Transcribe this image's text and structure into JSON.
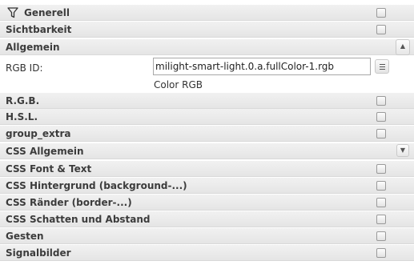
{
  "groups_top": [
    {
      "label": "Generell",
      "icon": "filter-icon"
    },
    {
      "label": "Sichtbarkeit"
    },
    {
      "label": "Allgemein"
    }
  ],
  "rgb": {
    "label": "RGB ID:",
    "value": "milight-smart-light.0.a.fullColor-1.rgb",
    "hint": "Color RGB",
    "select_icon": "list-icon"
  },
  "groups_bottom": [
    {
      "label": "R.G.B."
    },
    {
      "label": "H.S.L."
    },
    {
      "label": "group_extra"
    },
    {
      "label": "CSS Allgemein"
    },
    {
      "label": "CSS Font & Text"
    },
    {
      "label": "CSS Hintergrund (background-...)"
    },
    {
      "label": "CSS Ränder (border-...)"
    },
    {
      "label": "CSS Schatten und Abstand"
    },
    {
      "label": "Gesten"
    },
    {
      "label": "Signalbilder"
    }
  ],
  "collapse_glyph": "▲",
  "expand_glyph": "▼"
}
